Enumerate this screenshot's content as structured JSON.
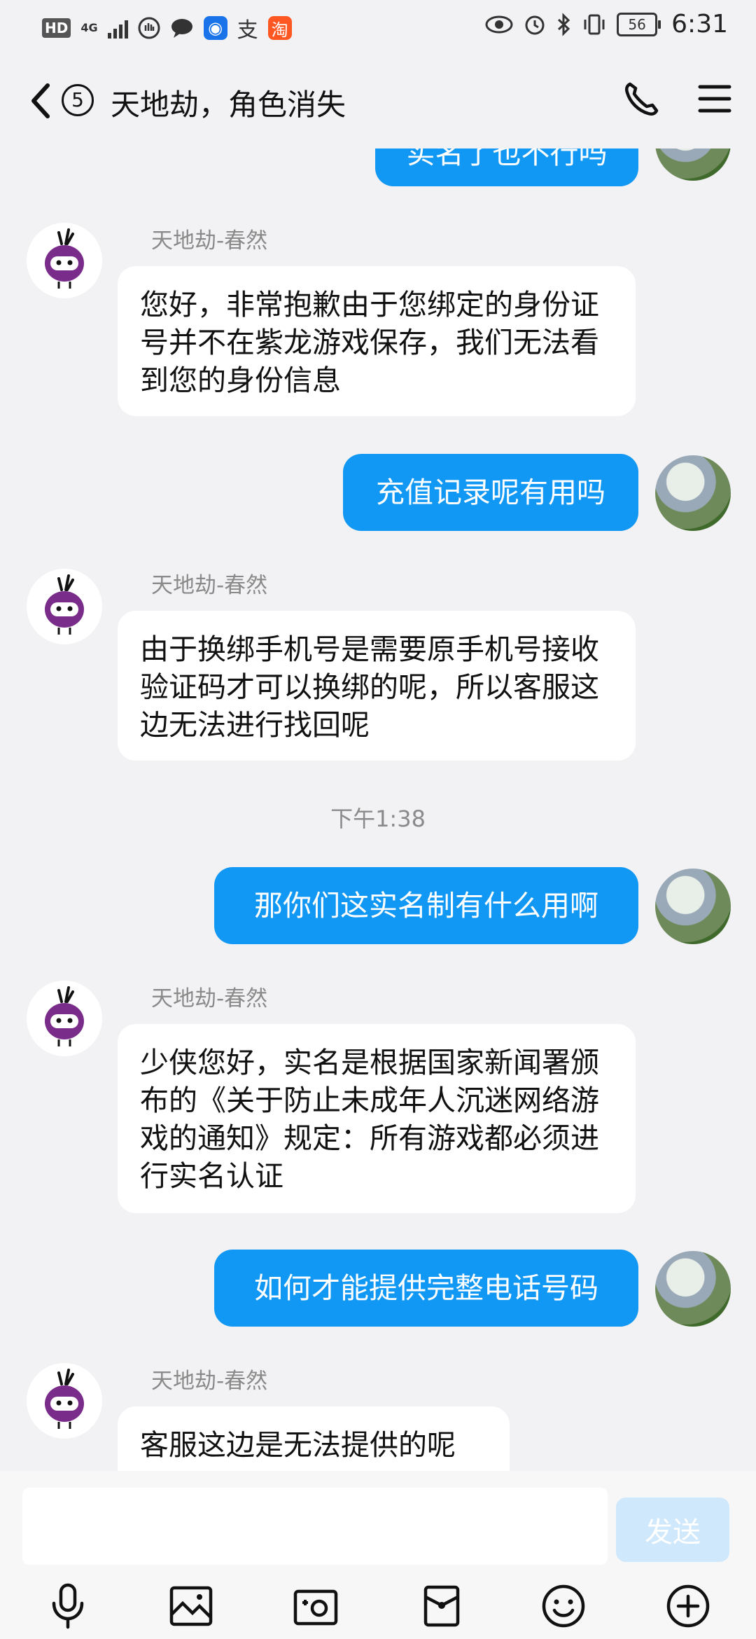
{
  "status_bar": {
    "hd": "HD",
    "network": "4G",
    "alipay_icon": "支",
    "taobao_icon": "淘",
    "battery": "56",
    "time": "6:31"
  },
  "header": {
    "unread_count": "5",
    "title": "天地劫，角色消失"
  },
  "chat": {
    "partial_outgoing": "实名了也不行吗",
    "messages": [
      {
        "side": "left",
        "sender": "天地劫-春然",
        "text": "您好，非常抱歉由于您绑定的身份证号并不在紫龙游戏保存，我们无法看到您的身份信息"
      },
      {
        "side": "right",
        "text": "充值记录呢有用吗"
      },
      {
        "side": "left",
        "sender": "天地劫-春然",
        "text": "由于换绑手机号是需要原手机号接收验证码才可以换绑的呢，所以客服这边无法进行找回呢"
      },
      {
        "side": "right",
        "text": "那你们这实名制有什么用啊"
      },
      {
        "side": "left",
        "sender": "天地劫-春然",
        "text": "少侠您好，实名是根据国家新闻署颁布的《关于防止未成年人沉迷网络游戏的通知》规定：所有游戏都必须进行实名认证"
      },
      {
        "side": "right",
        "text": "如何才能提供完整电话号码"
      },
      {
        "side": "left",
        "sender": "天地劫-春然",
        "text": "客服这边是无法提供的呢"
      }
    ],
    "timestamp": "下午1:38"
  },
  "input": {
    "value": "",
    "send_label": "发送"
  },
  "toolbar": {
    "icons": [
      "microphone-icon",
      "image-icon",
      "camera-icon",
      "red-packet-icon",
      "emoji-icon",
      "plus-icon"
    ]
  },
  "colors": {
    "outgoing_bubble": "#1197f4",
    "send_disabled": "#cfe8fb",
    "background": "#f2f2f4"
  }
}
